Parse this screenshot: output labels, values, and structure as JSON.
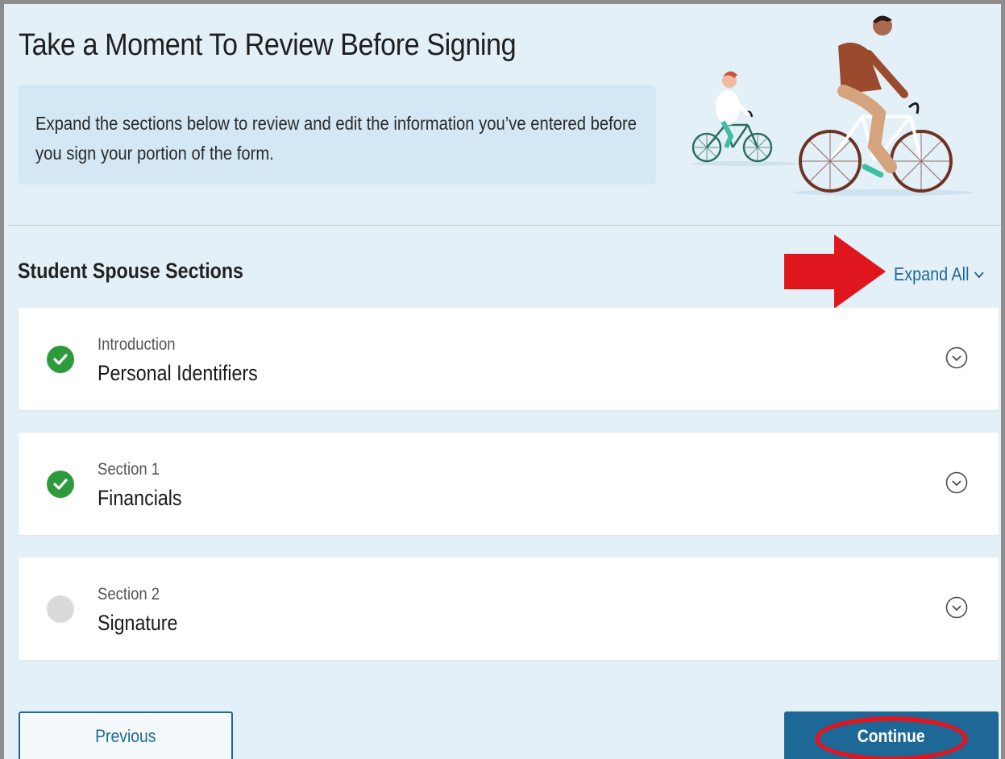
{
  "page": {
    "title": "Take a Moment To Review Before Signing",
    "info_text": "Expand the sections below to review and edit the information you’ve entered before you sign your portion of the form."
  },
  "sections": {
    "heading": "Student Spouse Sections",
    "expand_all_label": "Expand All",
    "items": [
      {
        "kicker": "Introduction",
        "title": "Personal Identifiers",
        "status": "complete",
        "status_icon": "check-circle-icon"
      },
      {
        "kicker": "Section 1",
        "title": "Financials",
        "status": "complete",
        "status_icon": "check-circle-icon"
      },
      {
        "kicker": "Section 2",
        "title": "Signature",
        "status": "incomplete",
        "status_icon": "empty-circle-icon"
      }
    ]
  },
  "footer": {
    "previous_label": "Previous",
    "continue_label": "Continue"
  },
  "colors": {
    "background": "#e4f0f8",
    "info_box": "#d3e8f4",
    "accent": "#1d6896",
    "complete": "#2f9a3b",
    "incomplete": "#dadada",
    "annotation_red": "#e0161f"
  }
}
